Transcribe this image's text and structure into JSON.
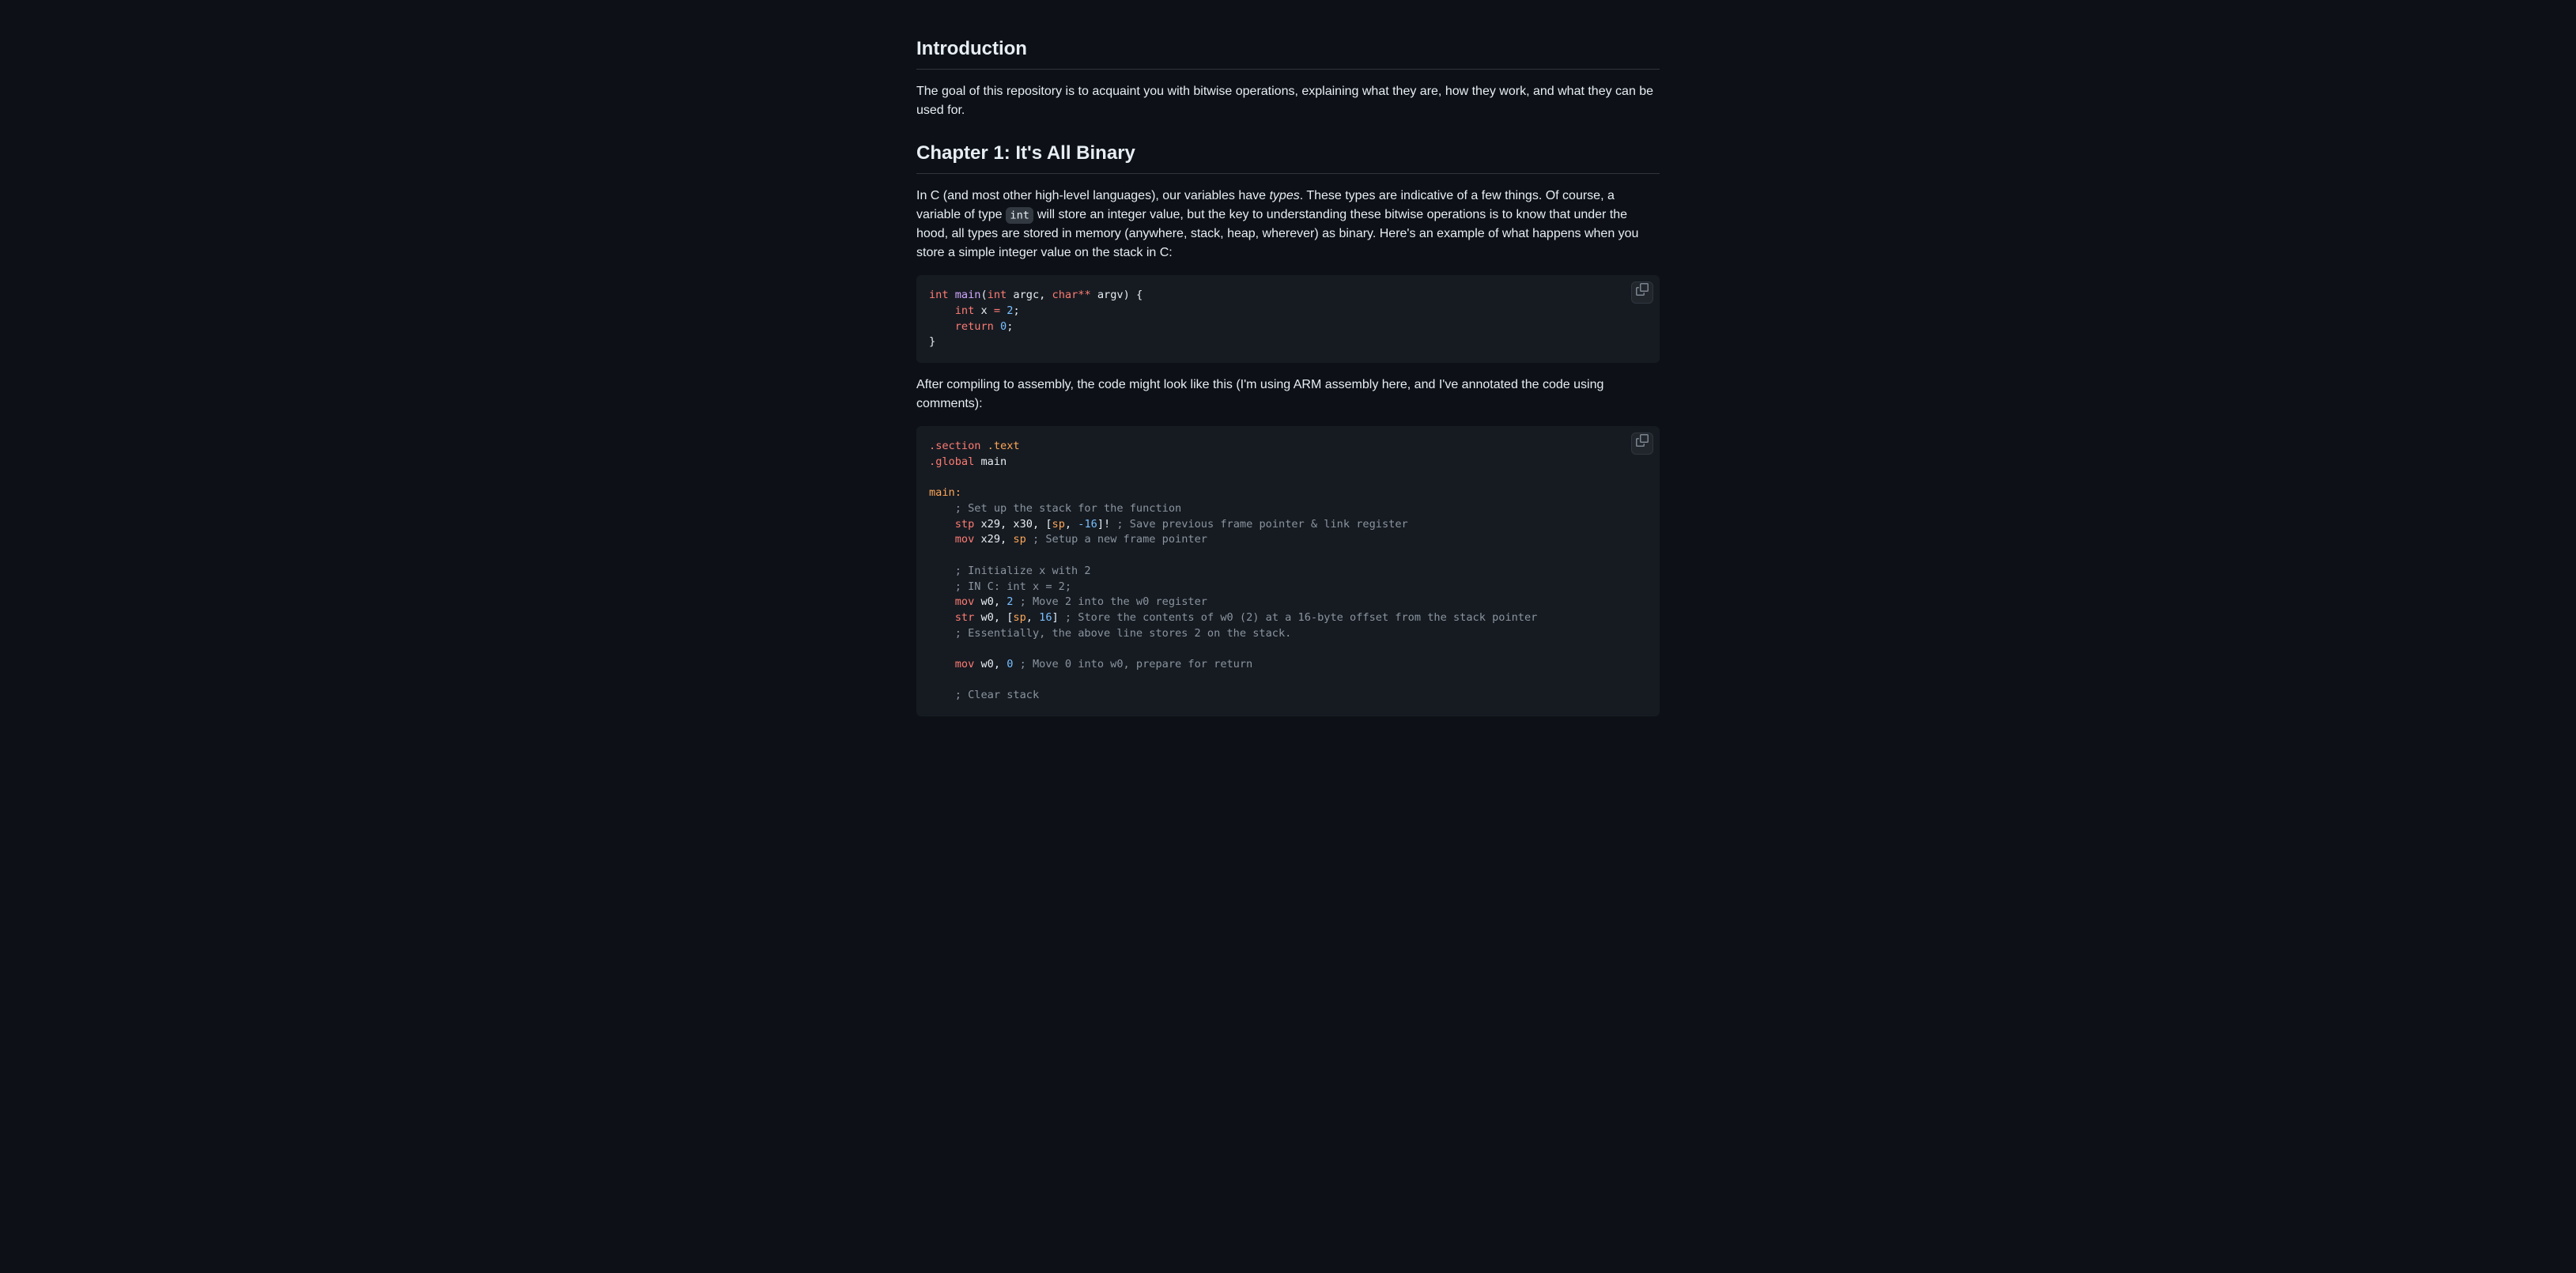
{
  "headings": {
    "intro": "Introduction",
    "chapter1": "Chapter 1: It's All Binary"
  },
  "paragraphs": {
    "intro_body": "The goal of this repository is to acquaint you with bitwise operations, explaining what they are, how they work, and what they can be used for.",
    "c_body_1": "In C (and most other high-level languages), our variables have ",
    "c_body_types": "types",
    "c_body_2": ". These types are indicative of a few things. Of course, a variable of type ",
    "c_inline_int": "int",
    "c_body_3": " will store an integer value, but the key to understanding these bitwise operations is to know that under the hood, all types are stored in memory (anywhere, stack, heap, wherever) as binary. Here's an example of what happens when you store a simple integer value on the stack in C:",
    "after_compile": "After compiling to assembly, the code might look like this (I'm using ARM assembly here, and I've annotated the code using comments):"
  },
  "code1": {
    "t_int": "int",
    "t_main": "main",
    "t_open_paren": "(",
    "t_int2": "int",
    "t_argc": " argc, ",
    "t_char": "char",
    "t_stars": "**",
    "t_argv": " argv) {",
    "t_line2_int": "int",
    "t_line2_rest": " x ",
    "t_eq": "=",
    "t_space": " ",
    "t_2": "2",
    "t_semi": ";",
    "t_return": "return",
    "t_ret_space": " ",
    "t_0": "0",
    "t_semi2": ";",
    "t_brace": "}"
  },
  "code2": {
    "dot1": ".",
    "section": "section",
    "dottext": " .text",
    "dot2": ".",
    "global": "global",
    "main": " main",
    "mainlabel": "main:",
    "c_setup": "    ; Set up the stack for the function",
    "stp": "stp",
    "stp_args1": " x29, x30, [",
    "sp1": "sp",
    "stp_args2": ", ",
    "neg16": "-16",
    "stp_args3": "]! ",
    "c_save": "; Save previous frame pointer & link register",
    "mov1": "mov",
    "mov1_args": " x29, ",
    "sp2": "sp",
    "mov1_sp": " ",
    "c_setup2": "; Setup a new frame pointer",
    "c_init": "    ; Initialize x with 2",
    "c_inc": "    ; IN C: int x = 2;",
    "mov2": "mov",
    "mov2_args": " w0, ",
    "two": "2",
    "mov2_sp": " ",
    "c_move2": "; Move 2 into the w0 register",
    "str": "str",
    "str_args1": " w0, [",
    "sp3": "sp",
    "str_args2": ", ",
    "sixteen": "16",
    "str_args3": "] ",
    "c_store": "; Store the contents of w0 (2) at a 16-byte offset from the stack pointer",
    "c_ess": "    ; Essentially, the above line stores 2 on the stack.",
    "mov3": "mov",
    "mov3_args": " w0, ",
    "zero": "0",
    "mov3_sp": " ",
    "c_move0": "; Move 0 into w0, prepare for return",
    "c_clear": "    ; Clear stack"
  }
}
